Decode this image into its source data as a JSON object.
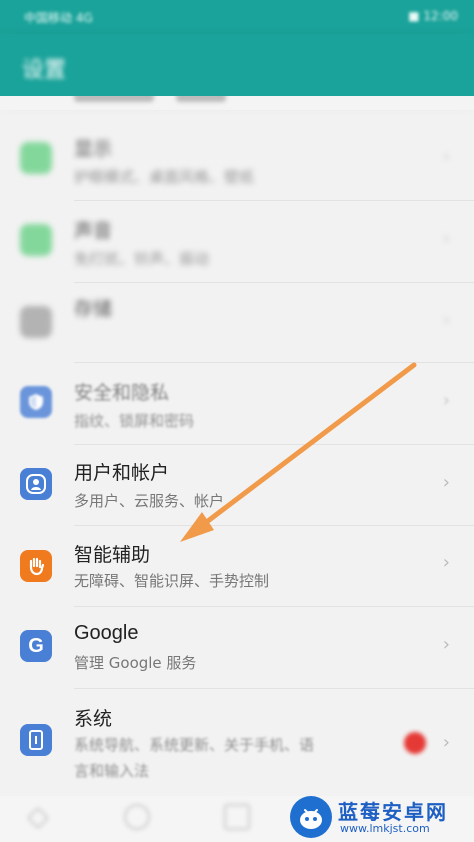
{
  "status_bar": {
    "carrier": "中国移动 4G",
    "right": "■ 12:00"
  },
  "app_bar": {
    "title": "设置"
  },
  "rows": [
    {
      "title": "显示",
      "subtitle": "护眼模式、桌面风格、壁纸",
      "icon": "display-icon",
      "color": "#5fcf7f"
    },
    {
      "title": "声音",
      "subtitle": "免打扰、铃声、振动",
      "icon": "sound-icon",
      "color": "#5fcf7f"
    },
    {
      "title": "存储",
      "subtitle": "",
      "icon": "storage-icon",
      "color": "#9e9e9e"
    },
    {
      "title": "安全和隐私",
      "subtitle": "指纹、锁屏和密码",
      "icon": "shield-icon",
      "color": "#4a7fd6"
    },
    {
      "title": "用户和帐户",
      "subtitle": "多用户、云服务、帐户",
      "icon": "user-icon",
      "color": "#4a7fd6"
    },
    {
      "title": "智能辅助",
      "subtitle": "无障碍、智能识屏、手势控制",
      "icon": "hand-icon",
      "color": "#f07a1e"
    },
    {
      "title": "Google",
      "subtitle": "管理 Google 服务",
      "icon": "google-icon",
      "color": "#4a7fd6"
    },
    {
      "title": "系统",
      "subtitle": "系统导航、系统更新、关于手机、语",
      "subtitle2": "言和输入法",
      "icon": "system-icon",
      "color": "#4a7fd6"
    }
  ],
  "annotation": {
    "arrow_color": "#f09a4a"
  },
  "watermark": {
    "name": "蓝莓安卓网",
    "url": "www.lmkjst.com"
  }
}
